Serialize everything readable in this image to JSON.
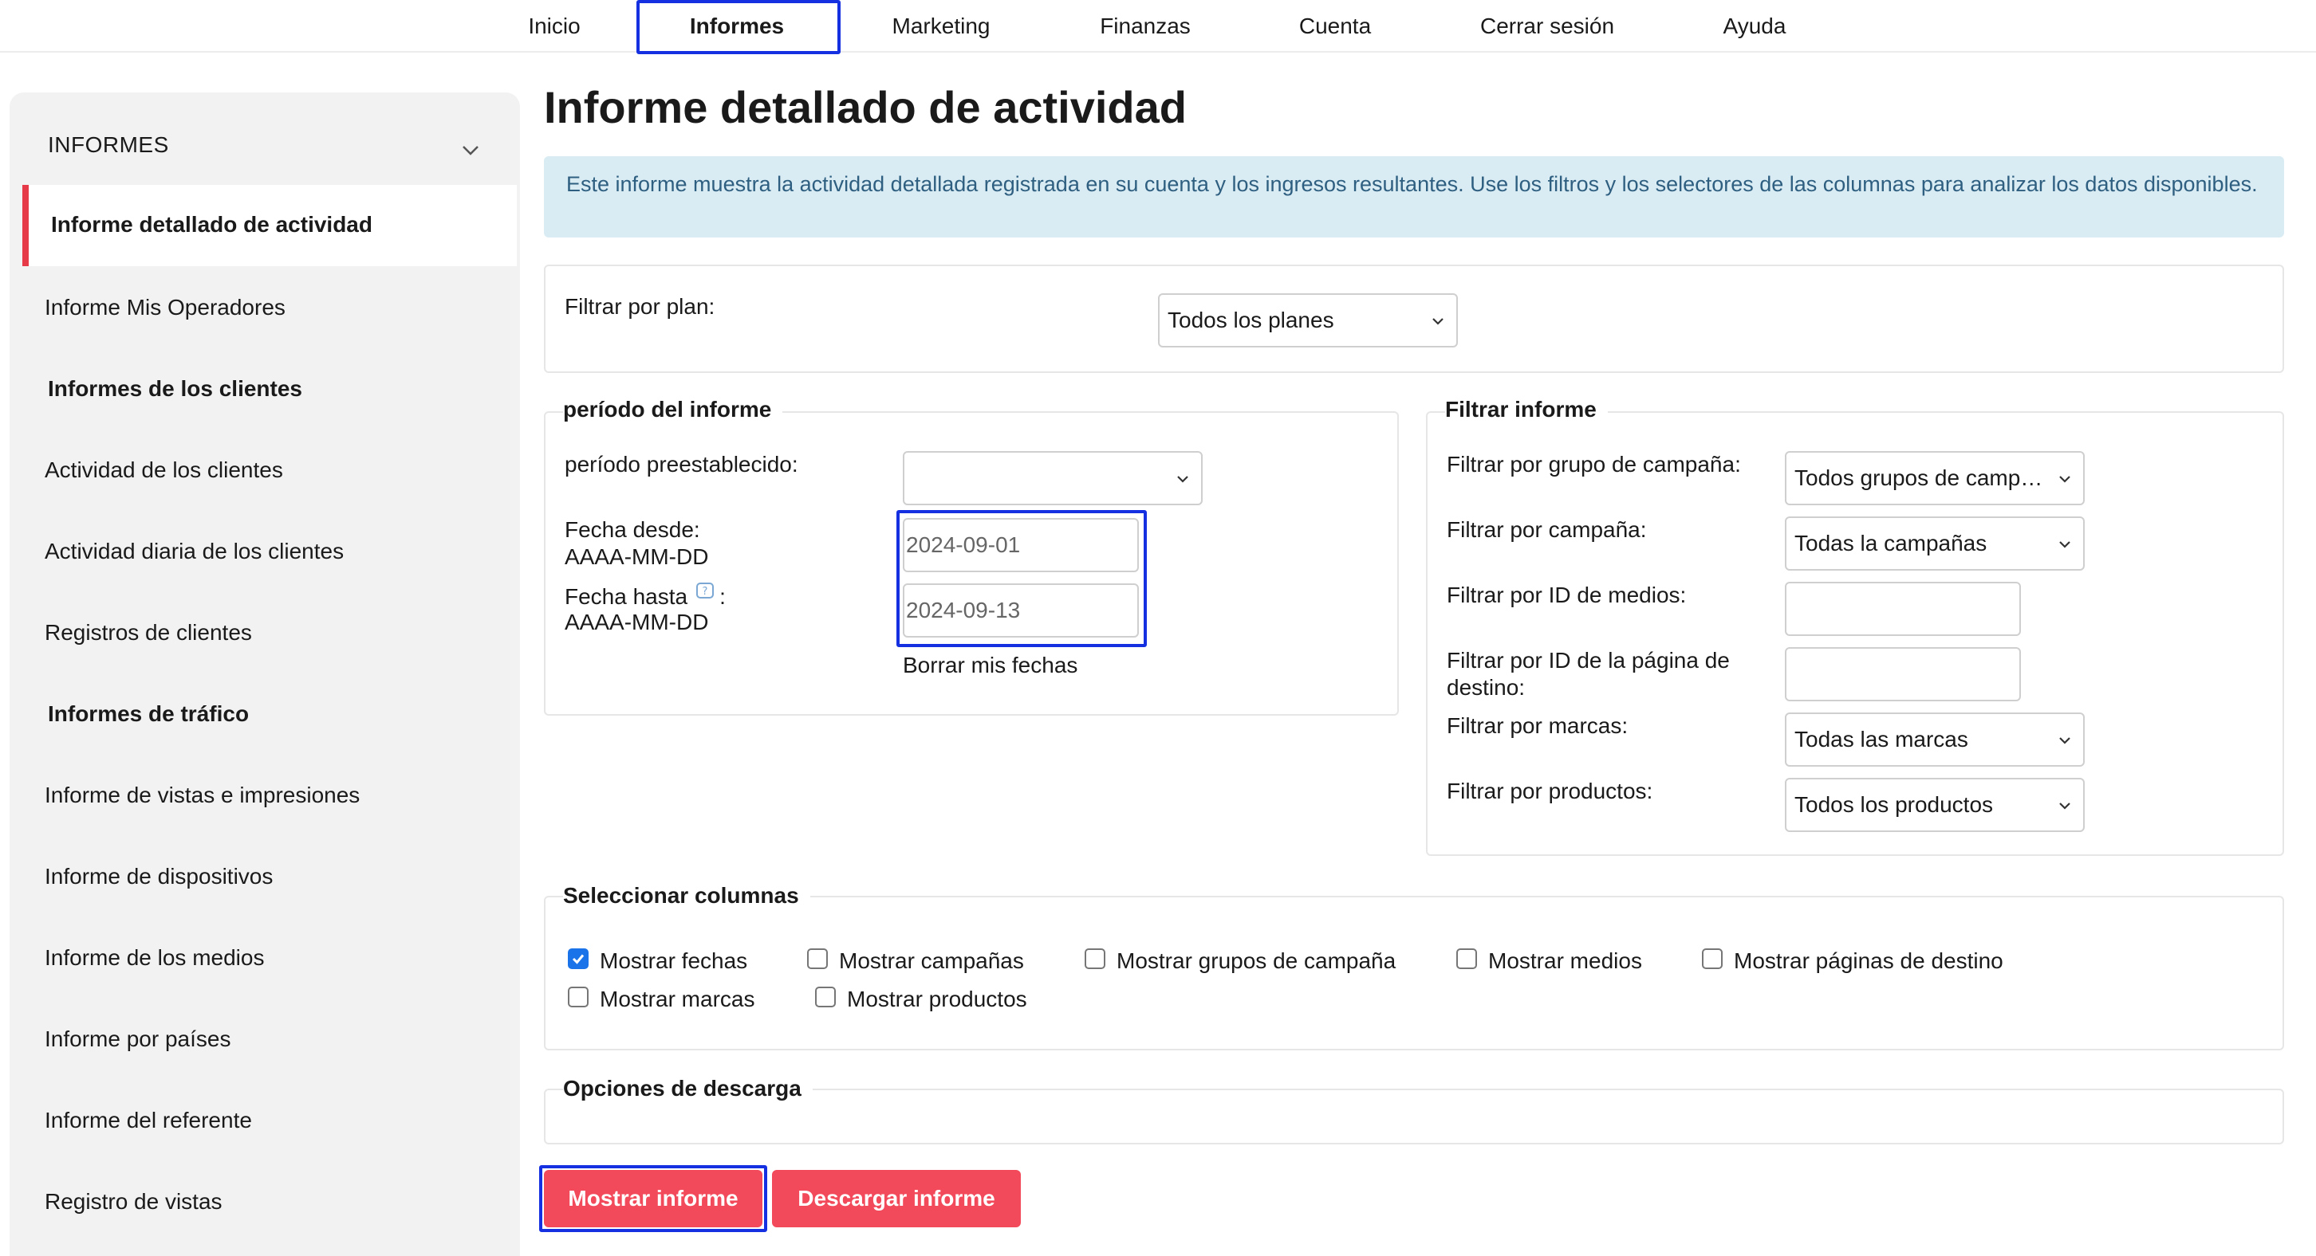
{
  "nav": {
    "items": [
      "Inicio",
      "Informes",
      "Marketing",
      "Finanzas",
      "Cuenta",
      "Cerrar sesión",
      "Ayuda"
    ],
    "active": "Informes"
  },
  "sidebar": {
    "header": "INFORMES",
    "active_item": "Informe detallado de actividad",
    "item_operadores": "Informe Mis Operadores",
    "section_clientes": "Informes de los clientes",
    "item_actividad_clientes": "Actividad de los clientes",
    "item_actividad_diaria": "Actividad diaria de los clientes",
    "item_registros": "Registros de clientes",
    "section_trafico": "Informes de tráfico",
    "item_vistas": "Informe de vistas e impresiones",
    "item_dispositivos": "Informe de dispositivos",
    "item_medios": "Informe de los medios",
    "item_paises": "Informe por países",
    "item_referente": "Informe del referente",
    "item_registro_vistas": "Registro de vistas"
  },
  "main": {
    "title": "Informe detallado de actividad",
    "info": "Este informe muestra la actividad detallada registrada en su cuenta y los ingresos resultantes. Use los filtros y los selectores de las columnas para analizar los datos disponibles."
  },
  "plan_filter": {
    "label": "Filtrar por plan:",
    "value": "Todos los planes"
  },
  "period": {
    "legend": "período del informe",
    "preset_label": "período preestablecido:",
    "preset_value": "",
    "from_label": "Fecha desde:",
    "from_format": "AAAA-MM-DD",
    "from_value": "2024-09-01",
    "to_label": "Fecha hasta",
    "to_suffix": ":",
    "to_format": "AAAA-MM-DD",
    "to_value": "2024-09-13",
    "clear_label": "Borrar mis fechas"
  },
  "filters": {
    "legend": "Filtrar informe",
    "campaign_group_label": "Filtrar por grupo de campaña:",
    "campaign_group_value": "Todos grupos de campaña",
    "campaign_label": "Filtrar por campaña:",
    "campaign_value": "Todas la campañas",
    "media_id_label": "Filtrar por ID de medios:",
    "media_id_value": "",
    "landing_label_1": "Filtrar por ID de la página de",
    "landing_label_2": "destino:",
    "landing_value": "",
    "brands_label": "Filtrar por marcas:",
    "brands_value": "Todas las marcas",
    "products_label": "Filtrar por productos:",
    "products_value": "Todos los productos"
  },
  "columns": {
    "legend": "Seleccionar columnas",
    "options": [
      {
        "label": "Mostrar fechas",
        "checked": true
      },
      {
        "label": "Mostrar campañas",
        "checked": false
      },
      {
        "label": "Mostrar grupos de campaña",
        "checked": false
      },
      {
        "label": "Mostrar medios",
        "checked": false
      },
      {
        "label": "Mostrar páginas de destino",
        "checked": false
      },
      {
        "label": "Mostrar marcas",
        "checked": false
      },
      {
        "label": "Mostrar productos",
        "checked": false
      }
    ]
  },
  "download": {
    "legend": "Opciones de descarga"
  },
  "buttons": {
    "show": "Mostrar informe",
    "download": "Descargar informe"
  },
  "colors": {
    "accent": "#f24a5a",
    "focus": "#1530e0",
    "info_bg": "#d9ecf4",
    "checkbox": "#1a73e8"
  }
}
